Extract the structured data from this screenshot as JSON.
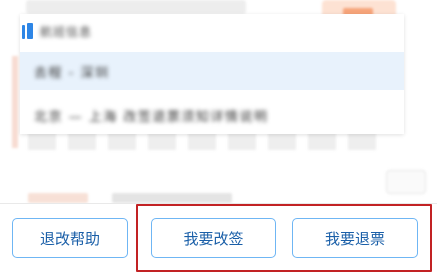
{
  "popup": {
    "header_title": "航班信息",
    "options": [
      {
        "label": "去程 - 深圳",
        "selected": true
      },
      {
        "label": "北京 — 上海 改签退票须知详情说明",
        "selected": false
      }
    ]
  },
  "actions": {
    "help_label": "退改帮助",
    "change_label": "我要改签",
    "refund_label": "我要退票"
  },
  "colors": {
    "button_border": "#6fb6f4",
    "button_text": "#1a5fa8",
    "selected_bg": "#e8f2fc",
    "highlight": "#c22224",
    "icon_blue": "#2e86e6"
  }
}
